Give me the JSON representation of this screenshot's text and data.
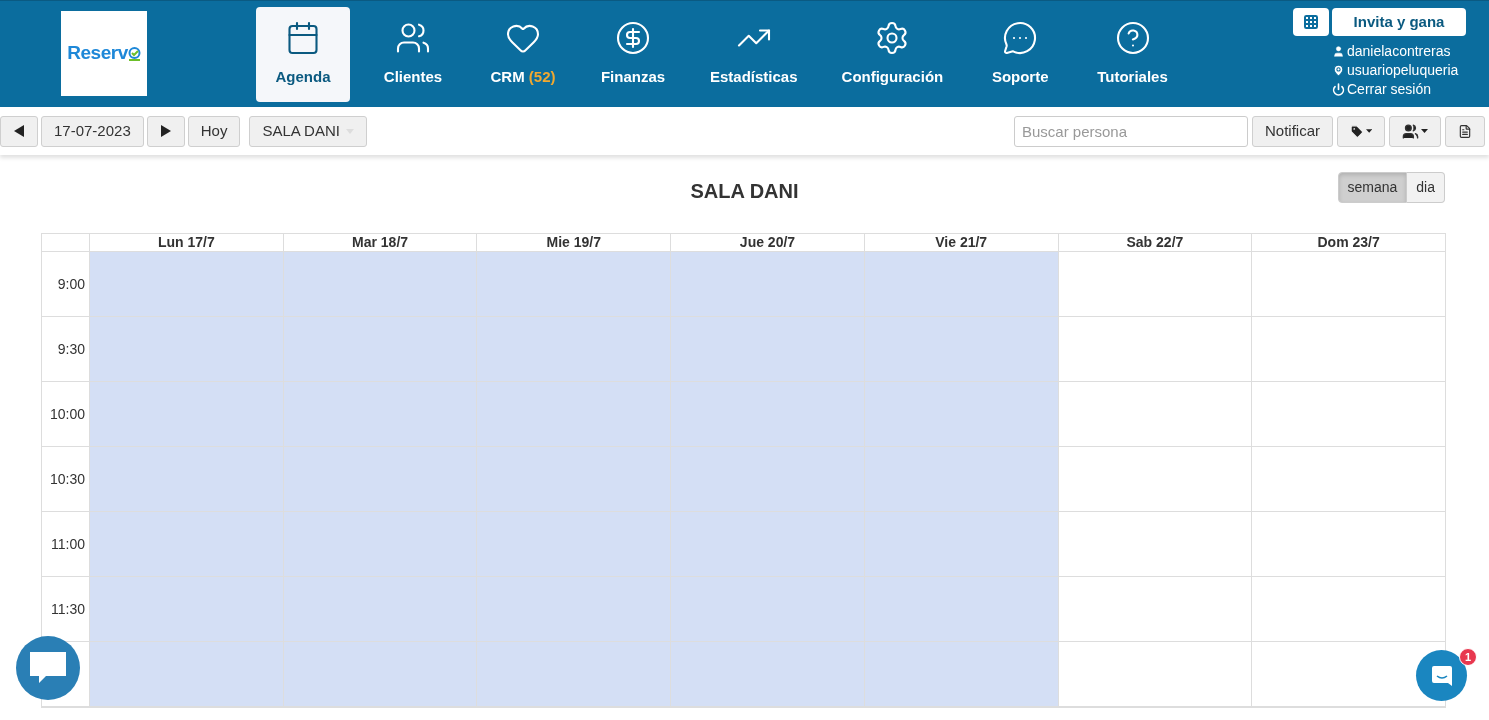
{
  "logo": {
    "text": "Reserv"
  },
  "nav": [
    {
      "kind": "calendar",
      "label": "Agenda",
      "selected": true
    },
    {
      "kind": "users",
      "label": "Clientes",
      "selected": false
    },
    {
      "kind": "heart",
      "label": "CRM",
      "count": "(52)",
      "selected": false
    },
    {
      "kind": "dollar",
      "label": "Finanzas",
      "selected": false
    },
    {
      "kind": "trend",
      "label": "Estadísticas",
      "selected": false
    },
    {
      "kind": "gear",
      "label": "Configuración",
      "selected": false
    },
    {
      "kind": "chat",
      "label": "Soporte",
      "selected": false
    },
    {
      "kind": "help",
      "label": "Tutoriales",
      "selected": false
    }
  ],
  "account": {
    "invite": "Invita y gana",
    "user": "danielacontreras",
    "location": "usuariopeluqueria",
    "logout": "Cerrar sesión"
  },
  "toolbar": {
    "date": "17-07-2023",
    "today": "Hoy",
    "room": "SALA DANI",
    "search_placeholder": "Buscar persona",
    "notify": "Notificar"
  },
  "calendar": {
    "title": "SALA DANI",
    "views": [
      {
        "label": "semana",
        "selected": true
      },
      {
        "label": "dia",
        "selected": false
      }
    ],
    "days": [
      {
        "label": "Lun 17/7",
        "available": true
      },
      {
        "label": "Mar 18/7",
        "available": true
      },
      {
        "label": "Mie 19/7",
        "available": true
      },
      {
        "label": "Jue 20/7",
        "available": true
      },
      {
        "label": "Vie 21/7",
        "available": true
      },
      {
        "label": "Sab 22/7",
        "available": false
      },
      {
        "label": "Dom 23/7",
        "available": false
      }
    ],
    "times": [
      "9:00",
      "9:30",
      "10:00",
      "10:30",
      "11:00",
      "11:30"
    ]
  },
  "chat_widget": {
    "badge": "1"
  }
}
